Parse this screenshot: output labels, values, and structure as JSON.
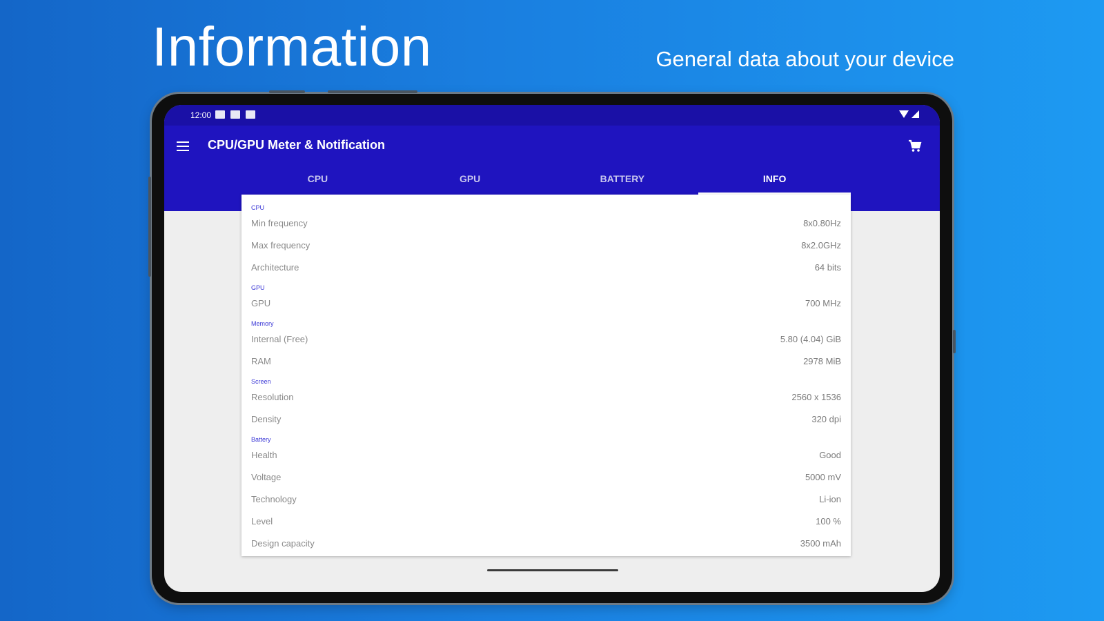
{
  "hero": {
    "title": "Information",
    "subtitle": "General data about your device"
  },
  "status_bar": {
    "time": "12:00"
  },
  "toolbar": {
    "title": "CPU/GPU Meter & Notification",
    "menu_icon": "hamburger-menu-icon",
    "cart_icon": "shopping-cart-icon"
  },
  "tabs": [
    {
      "label": "CPU",
      "active": false
    },
    {
      "label": "GPU",
      "active": false
    },
    {
      "label": "BATTERY",
      "active": false
    },
    {
      "label": "INFO",
      "active": true
    }
  ],
  "sections": {
    "cpu": {
      "title": "CPU",
      "rows": [
        {
          "label": "Min frequency",
          "value": "8x0.80Hz"
        },
        {
          "label": "Max frequency",
          "value": "8x2.0GHz"
        },
        {
          "label": "Architecture",
          "value": "64 bits"
        }
      ]
    },
    "gpu": {
      "title": "GPU",
      "rows": [
        {
          "label": "GPU",
          "value": "700 MHz"
        }
      ]
    },
    "memory": {
      "title": "Memory",
      "rows": [
        {
          "label": "Internal (Free)",
          "value": "5.80 (4.04) GiB"
        },
        {
          "label": "RAM",
          "value": "2978 MiB"
        }
      ]
    },
    "screen": {
      "title": "Screen",
      "rows": [
        {
          "label": "Resolution",
          "value": "2560 x 1536"
        },
        {
          "label": "Density",
          "value": "320 dpi"
        }
      ]
    },
    "battery": {
      "title": "Battery",
      "rows": [
        {
          "label": "Health",
          "value": "Good"
        },
        {
          "label": "Voltage",
          "value": "5000 mV"
        },
        {
          "label": "Technology",
          "value": "Li-ion"
        },
        {
          "label": "Level",
          "value": "100 %"
        },
        {
          "label": "Design capacity",
          "value": "3500 mAh"
        }
      ]
    }
  },
  "colors": {
    "app_bar": "#1f14bf",
    "status_bar": "#1a10a6",
    "section_title": "#3b38d6",
    "background_gradient_start": "#1466c8",
    "background_gradient_end": "#1d9af2"
  }
}
